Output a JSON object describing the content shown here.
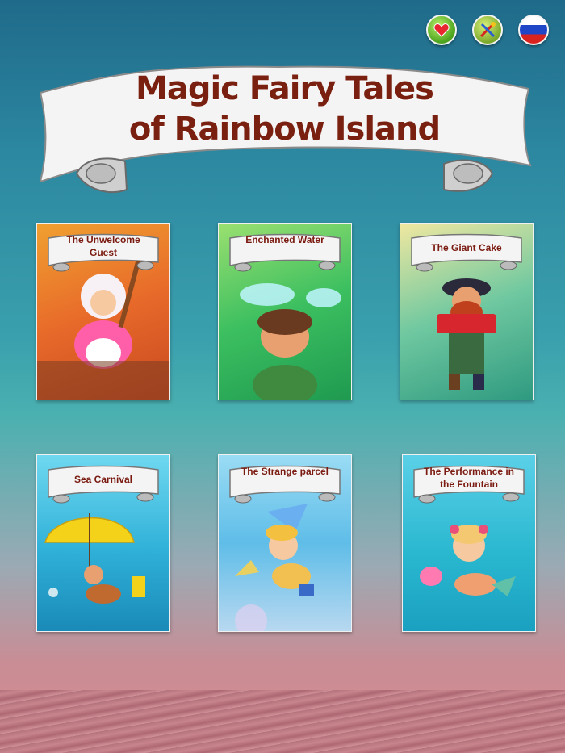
{
  "title": {
    "line1": "Magic Fairy Tales",
    "line2": "of Rainbow Island"
  },
  "toolbar": {
    "icons": [
      "heart-icon",
      "tools-icon",
      "russian-flag-icon"
    ]
  },
  "books": [
    {
      "title": "The Unwelcome Guest"
    },
    {
      "title": "Enchanted Water"
    },
    {
      "title": "The Giant Cake"
    },
    {
      "title": "Sea Carnival"
    },
    {
      "title": "The Strange parcel"
    },
    {
      "title": "The Performance in the Fountain"
    }
  ],
  "colors": {
    "title_text": "#7a2010",
    "background_top": "#1f6a8a",
    "background_bottom": "#d88a8e"
  }
}
